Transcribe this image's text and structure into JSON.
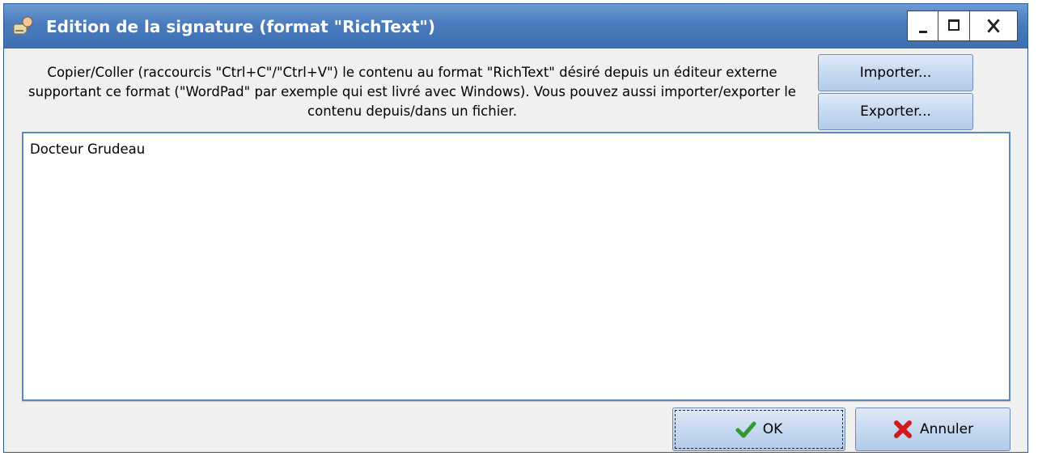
{
  "window": {
    "title": "Edition de la signature (format \"RichText\")",
    "controls": {
      "minimize": "_",
      "maximize": "□",
      "close": "X"
    }
  },
  "info_text": "Copier/Coller (raccourcis \"Ctrl+C\"/\"Ctrl+V\") le contenu au format \"RichText\" désiré depuis un éditeur externe supportant ce format (\"WordPad\" par exemple qui est livré avec Windows). Vous pouvez aussi importer/exporter le contenu depuis/dans un fichier.",
  "buttons": {
    "import": "Importer...",
    "export": "Exporter...",
    "ok": "OK",
    "cancel": "Annuler"
  },
  "editor": {
    "content": "Docteur Grudeau"
  },
  "icons": {
    "title": "signature-app-icon",
    "ok": "checkmark-icon",
    "cancel": "red-x-icon"
  },
  "colors": {
    "titlebar": "#4a7bbd",
    "button_face": "#c6d9f0",
    "editor_border": "#5a86c8",
    "ok_check": "#2f9a2f",
    "cancel_x": "#d11a1a"
  }
}
